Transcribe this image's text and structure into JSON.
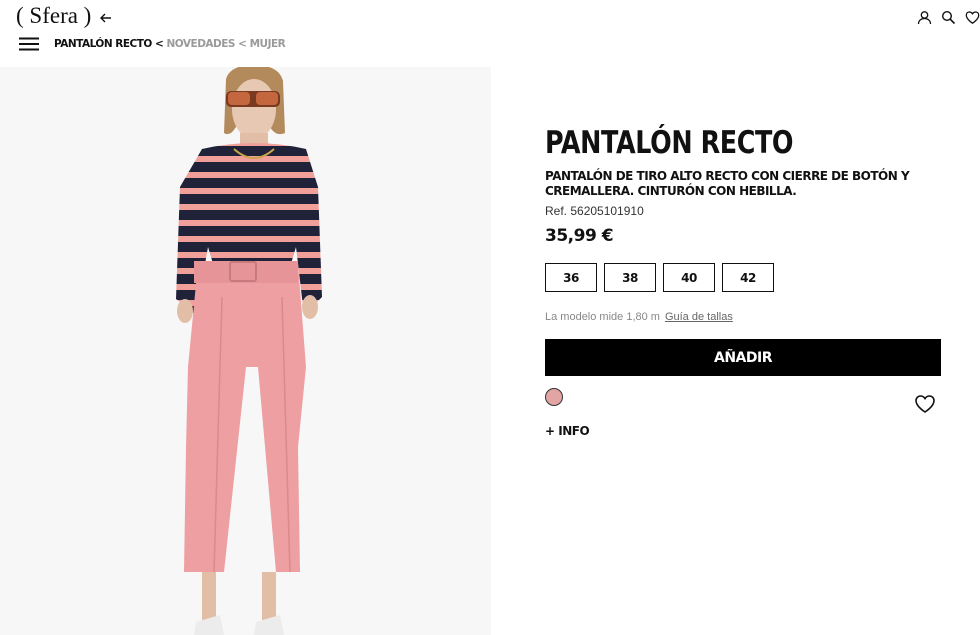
{
  "header": {
    "logo": "( Sfera )",
    "breadcrumb": {
      "current": "PANTALÓN RECTO",
      "sep1": " < ",
      "novedades": "NOVEDADES",
      "sep2": " < ",
      "mujer": "MUJER"
    },
    "icons": [
      "back-arrow-icon",
      "hamburger-menu-icon",
      "user-icon",
      "search-icon",
      "heart-icon"
    ]
  },
  "product": {
    "title": "PANTALÓN RECTO",
    "description": "PANTALÓN DE TIRO ALTO RECTO CON CIERRE DE BOTÓN Y CREMALLERA. CINTURÓN CON HEBILLA.",
    "ref": "Ref. 56205101910",
    "price": "35,99 €",
    "sizes": [
      "36",
      "38",
      "40",
      "42"
    ],
    "model_info": "La modelo mide 1,80 m",
    "size_guide": "Guía de tallas",
    "add_button": "AÑADIR",
    "color_swatch": "#e3a4a4",
    "more_info": "+ INFO"
  }
}
